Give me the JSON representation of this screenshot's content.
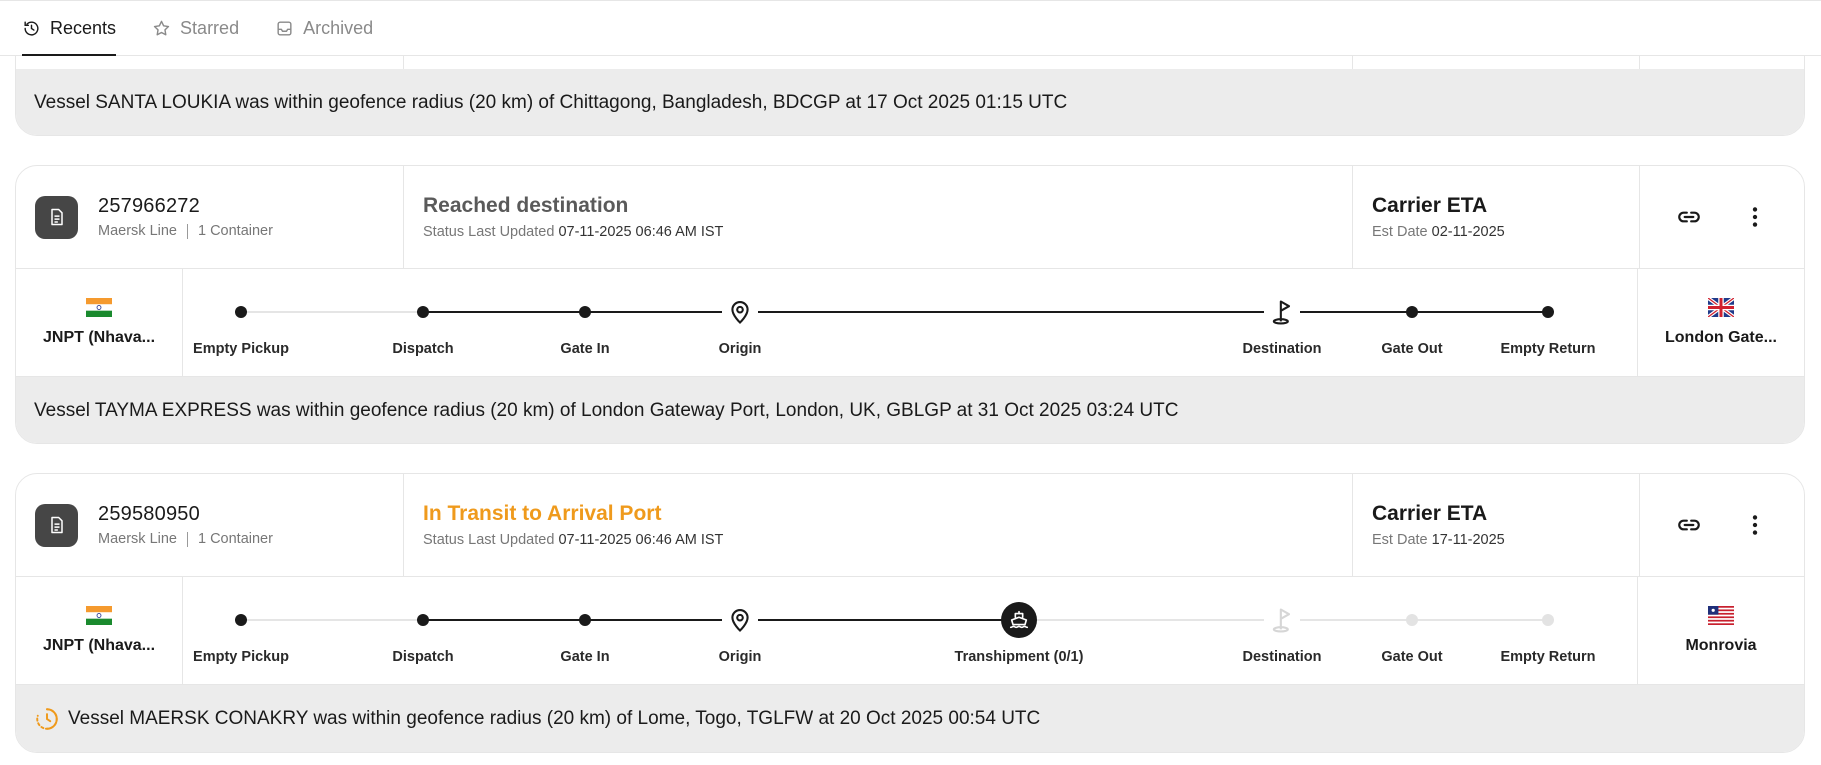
{
  "tabs": [
    {
      "label": "Recents",
      "active": true,
      "icon": "history-icon"
    },
    {
      "label": "Starred",
      "active": false,
      "icon": "star-icon"
    },
    {
      "label": "Archived",
      "active": false,
      "icon": "inbox-icon"
    }
  ],
  "partial_card": {
    "message": "Vessel SANTA LOUKIA was within geofence radius (20 km) of Chittagong, Bangladesh, BDCGP at 17 Oct 2025 01:15 UTC"
  },
  "shipments": [
    {
      "reference": "257966272",
      "carrier": "Maersk Line",
      "containers": "1 Container",
      "status": "Reached destination",
      "status_color": "#5a5a5a",
      "status_updated_label": "Status Last Updated",
      "status_updated": "07-11-2025 06:46 AM IST",
      "eta_title": "Carrier ETA",
      "eta_label": "Est Date",
      "eta_date": "02-11-2025",
      "origin_port": "JNPT (Nhava...",
      "origin_flag": "india-flag",
      "destination_port": "London Gate...",
      "destination_flag": "uk-flag",
      "milestones": [
        {
          "label": "Empty Pickup",
          "state": "done",
          "icon": "dot"
        },
        {
          "label": "Dispatch",
          "state": "done",
          "icon": "dot"
        },
        {
          "label": "Gate In",
          "state": "done",
          "icon": "dot"
        },
        {
          "label": "Origin",
          "state": "done",
          "icon": "location-pin-icon"
        },
        {
          "label": "Destination",
          "state": "done",
          "icon": "golf-flag-icon"
        },
        {
          "label": "Gate Out",
          "state": "done",
          "icon": "dot"
        },
        {
          "label": "Empty Return",
          "state": "done",
          "icon": "dot"
        }
      ],
      "message": "Vessel TAYMA EXPRESS was within geofence radius (20 km) of London Gateway Port, London, UK, GBLGP at 31 Oct 2025 03:24 UTC",
      "message_icon": null
    },
    {
      "reference": "259580950",
      "carrier": "Maersk Line",
      "containers": "1 Container",
      "status": "In Transit to Arrival Port",
      "status_color": "#ef9a1c",
      "status_updated_label": "Status Last Updated",
      "status_updated": "07-11-2025 06:46 AM IST",
      "eta_title": "Carrier ETA",
      "eta_label": "Est Date",
      "eta_date": "17-11-2025",
      "origin_port": "JNPT (Nhava...",
      "origin_flag": "india-flag",
      "destination_port": "Monrovia",
      "destination_flag": "liberia-flag",
      "milestones": [
        {
          "label": "Empty Pickup",
          "state": "done",
          "icon": "dot"
        },
        {
          "label": "Dispatch",
          "state": "done",
          "icon": "dot"
        },
        {
          "label": "Gate In",
          "state": "done",
          "icon": "dot"
        },
        {
          "label": "Origin",
          "state": "done",
          "icon": "location-pin-icon"
        },
        {
          "label": "Transhipment (0/1)",
          "state": "current",
          "icon": "ship-icon"
        },
        {
          "label": "Destination",
          "state": "pending",
          "icon": "golf-flag-icon"
        },
        {
          "label": "Gate Out",
          "state": "pending",
          "icon": "dot"
        },
        {
          "label": "Empty Return",
          "state": "pending",
          "icon": "dot"
        }
      ],
      "message": "Vessel MAERSK CONAKRY was within geofence radius (20 km) of Lome, Togo, TGLFW at 20 Oct 2025 00:54 UTC",
      "message_icon": "clock-icon"
    }
  ]
}
